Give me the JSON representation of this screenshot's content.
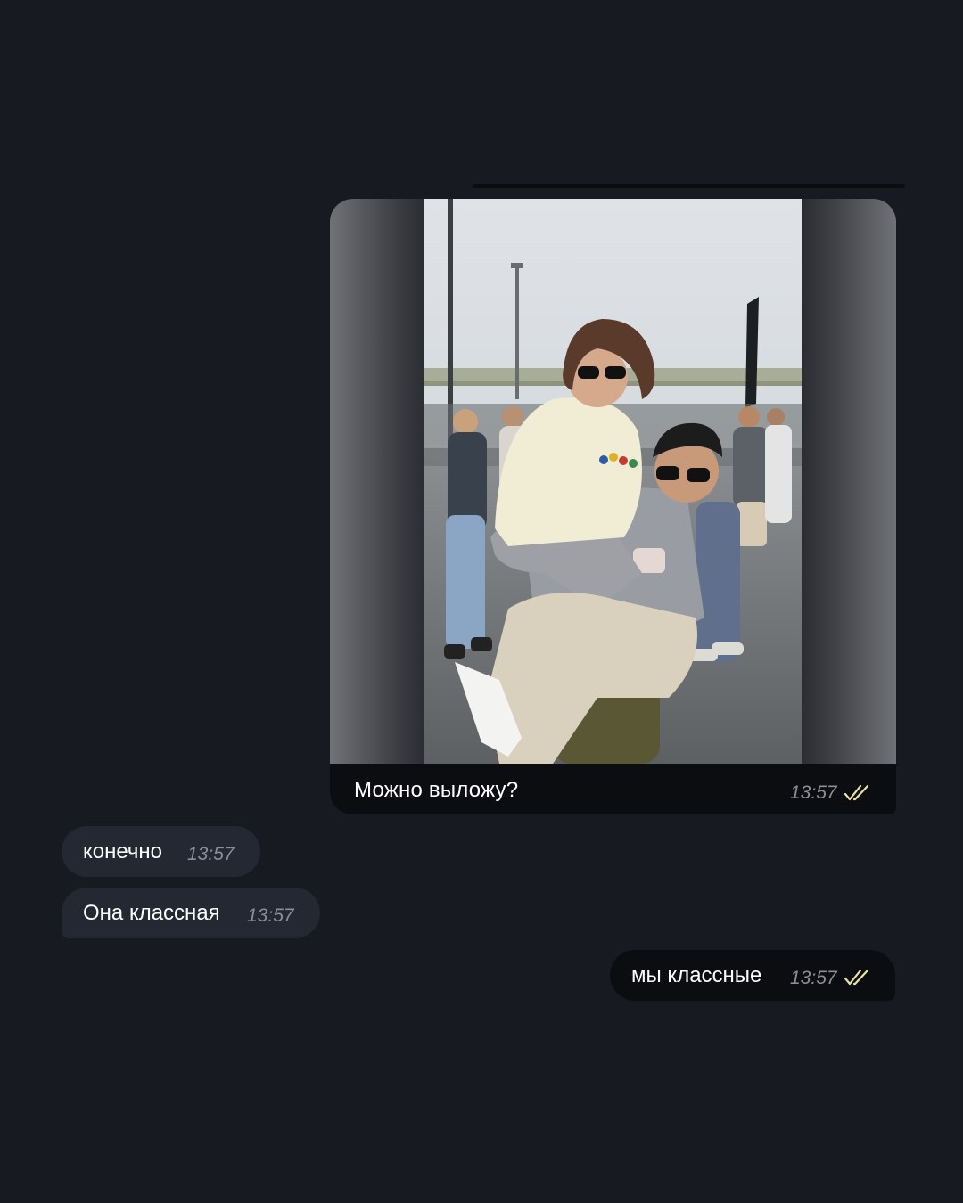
{
  "chat": {
    "messages": [
      {
        "direction": "outgoing",
        "type": "photo",
        "photo_icon": "photo-two-people-piggyback",
        "caption": "Можно выложу?",
        "time": "13:57",
        "status_icon": "double-check-icon"
      },
      {
        "direction": "incoming",
        "type": "text",
        "text": "конечно",
        "time": "13:57"
      },
      {
        "direction": "incoming",
        "type": "text",
        "text": "Она классная",
        "time": "13:57"
      },
      {
        "direction": "outgoing",
        "type": "text",
        "text": "мы классные",
        "time": "13:57",
        "status_icon": "double-check-icon"
      }
    ]
  },
  "colors": {
    "background": "#171a21",
    "outgoing_bubble": "#0c0d11",
    "incoming_bubble": "#242832",
    "timestamp": "#8b8e96",
    "read_checks": "#e9e2a0"
  }
}
